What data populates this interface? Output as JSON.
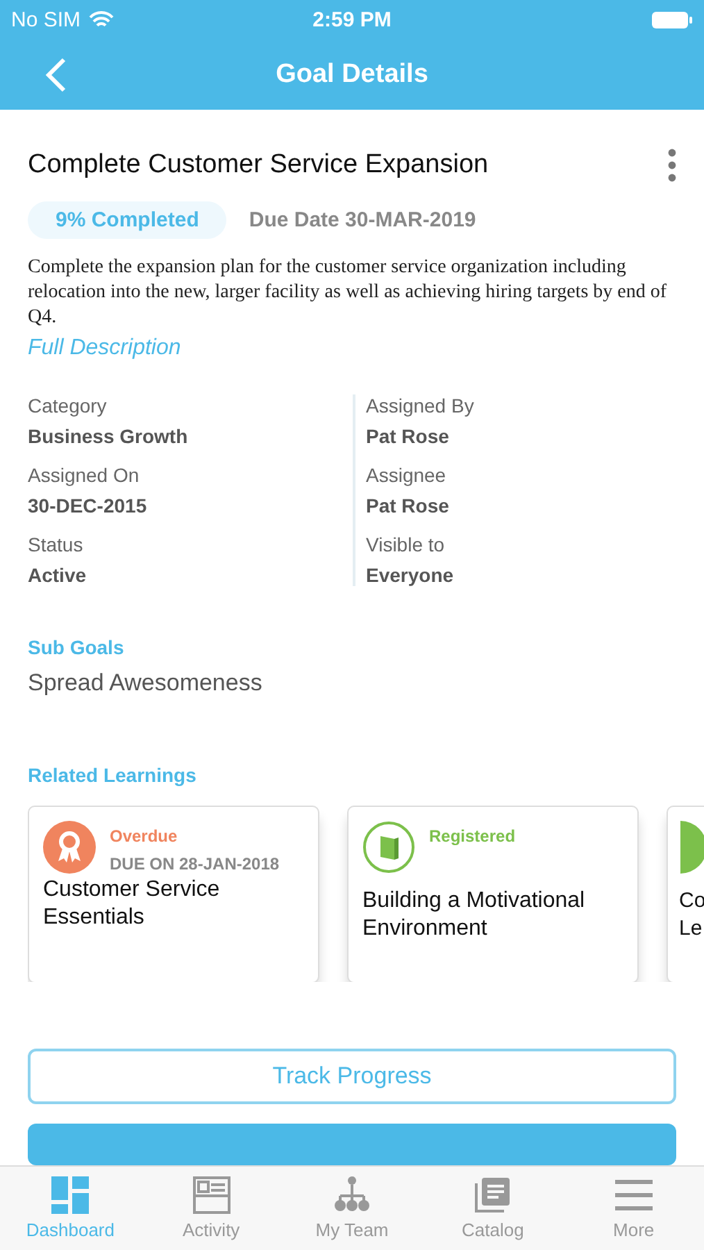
{
  "status_bar": {
    "carrier": "No SIM",
    "time": "2:59 PM"
  },
  "nav": {
    "title": "Goal Details"
  },
  "goal": {
    "title": "Complete Customer Service Expansion",
    "progress": "9% Completed",
    "due": "Due Date 30-MAR-2019",
    "description": "Complete the expansion plan for the customer service organization including relocation into the new, larger facility as well as achieving hiring targets by end of Q4.",
    "full_description_link": "Full Description"
  },
  "details": {
    "left": [
      {
        "label": "Category",
        "value": "Business Growth"
      },
      {
        "label": "Assigned On",
        "value": "30-DEC-2015"
      },
      {
        "label": "Status",
        "value": "Active"
      }
    ],
    "right": [
      {
        "label": "Assigned By",
        "value": "Pat Rose"
      },
      {
        "label": "Assignee",
        "value": "Pat Rose"
      },
      {
        "label": "Visible to",
        "value": "Everyone"
      }
    ]
  },
  "sub_goals": {
    "heading": "Sub Goals",
    "items": [
      "Spread Awesomeness"
    ]
  },
  "related_learnings": {
    "heading": "Related Learnings",
    "cards": [
      {
        "kind": "overdue",
        "status": "Overdue",
        "due": "DUE ON 28-JAN-2018",
        "title": "Customer Service Essentials"
      },
      {
        "kind": "registered",
        "status": "Registered",
        "title": "Building a Motivational Environment"
      },
      {
        "kind": "partial",
        "title": "Co Le"
      }
    ]
  },
  "actions": {
    "track_progress": "Track Progress"
  },
  "tab_bar": [
    {
      "label": "Dashboard",
      "kind": "dashboard",
      "selected": true
    },
    {
      "label": "Activity",
      "kind": "activity",
      "selected": false
    },
    {
      "label": "My Team",
      "kind": "team",
      "selected": false
    },
    {
      "label": "Catalog",
      "kind": "catalog",
      "selected": false
    },
    {
      "label": "More",
      "kind": "more",
      "selected": false
    }
  ]
}
